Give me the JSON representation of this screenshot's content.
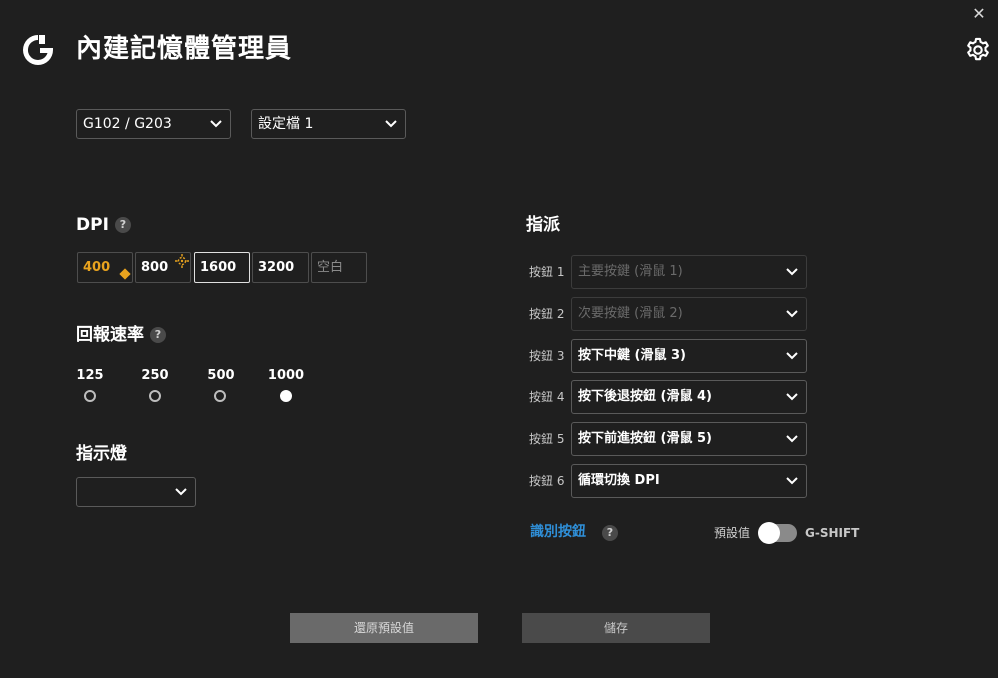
{
  "header": {
    "title": "內建記憶體管理員",
    "close_symbol": "✕",
    "icons": [
      "logitech-g-logo",
      "gear-icon",
      "close-icon"
    ]
  },
  "device_select": {
    "value": "G102 / G203"
  },
  "profile_select": {
    "value": "設定檔 1"
  },
  "dpi": {
    "title": "DPI",
    "help": "?",
    "levels": [
      {
        "label": "400",
        "is_default": true
      },
      {
        "label": "800",
        "is_shift": true
      },
      {
        "label": "1600",
        "selected": true
      },
      {
        "label": "3200"
      },
      {
        "label": "空白",
        "empty": true
      }
    ]
  },
  "report_rate": {
    "title": "回報速率",
    "help": "?",
    "options": [
      "125",
      "250",
      "500",
      "1000"
    ],
    "selected": "1000"
  },
  "indicator": {
    "title": "指示燈",
    "value": ""
  },
  "assignments": {
    "title": "指派",
    "buttons": [
      {
        "label": "按鈕 1",
        "value": "主要按鍵 (滑鼠 1)",
        "disabled": true
      },
      {
        "label": "按鈕 2",
        "value": "次要按鍵 (滑鼠 2)",
        "disabled": true
      },
      {
        "label": "按鈕 3",
        "value": "按下中鍵 (滑鼠 3)"
      },
      {
        "label": "按鈕 4",
        "value": "按下後退按鈕 (滑鼠 4)"
      },
      {
        "label": "按鈕 5",
        "value": "按下前進按鈕 (滑鼠 5)"
      },
      {
        "label": "按鈕 6",
        "value": "循環切換 DPI"
      }
    ],
    "identify_label": "識別按鈕",
    "identify_help": "?",
    "preset_label": "預設值",
    "gshift_label": "G-SHIFT",
    "gshift_on": false
  },
  "actions": {
    "restore_label": "還原預設值",
    "save_label": "儲存"
  },
  "colors": {
    "background": "#1f1f1f",
    "accent_default_dpi": "#e9a31e",
    "link": "#2f8fd8"
  }
}
